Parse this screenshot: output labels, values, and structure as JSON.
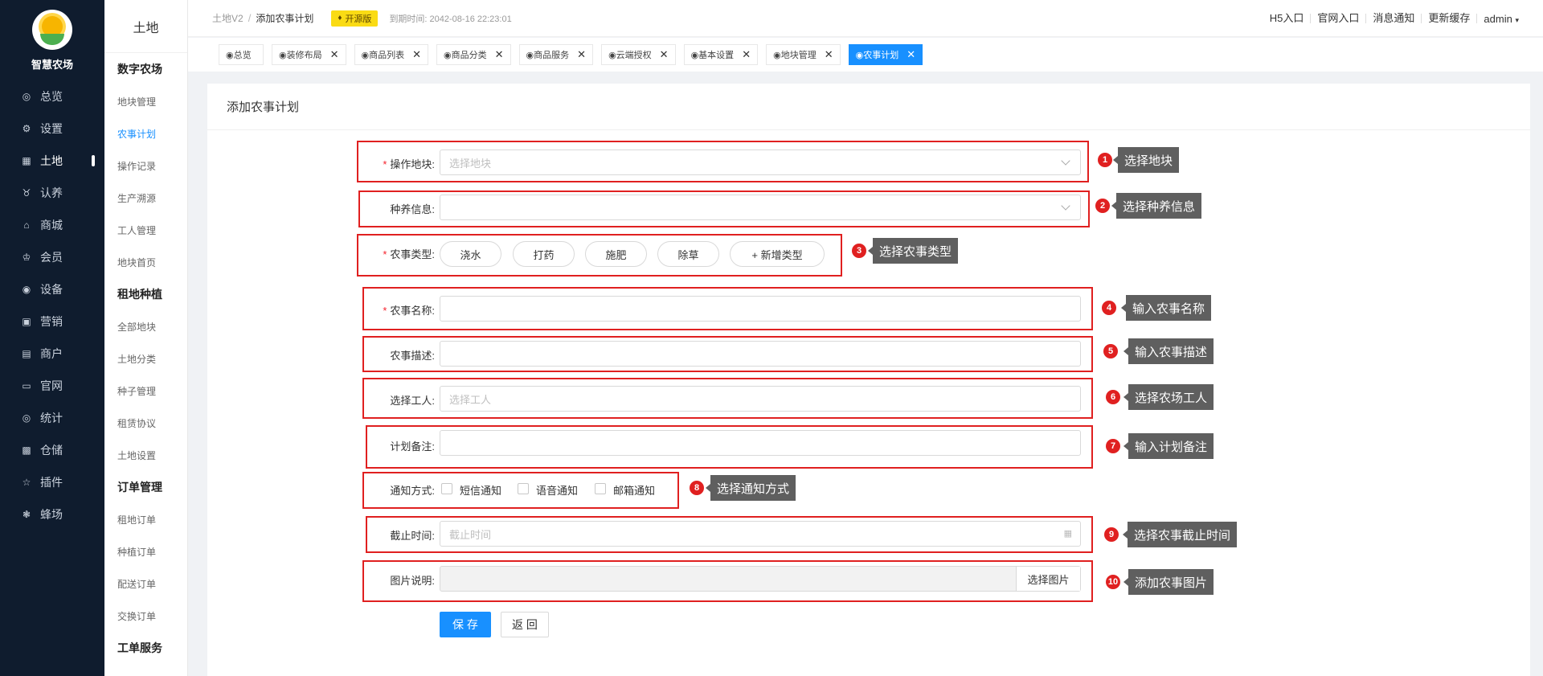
{
  "brand": {
    "name": "智慧农场"
  },
  "nav": [
    {
      "label": "总览",
      "icon": "dashboard-icon",
      "glyph": "◎"
    },
    {
      "label": "设置",
      "icon": "gear-icon",
      "glyph": "⚙"
    },
    {
      "label": "土地",
      "icon": "land-icon",
      "glyph": "▦"
    },
    {
      "label": "认养",
      "icon": "adopt-icon",
      "glyph": "♉"
    },
    {
      "label": "商城",
      "icon": "shop-icon",
      "glyph": "⌂"
    },
    {
      "label": "会员",
      "icon": "member-icon",
      "glyph": "♔"
    },
    {
      "label": "设备",
      "icon": "device-icon",
      "glyph": "◉"
    },
    {
      "label": "营销",
      "icon": "marketing-icon",
      "glyph": "▣"
    },
    {
      "label": "商户",
      "icon": "merchant-icon",
      "glyph": "▤"
    },
    {
      "label": "官网",
      "icon": "website-icon",
      "glyph": "▭"
    },
    {
      "label": "统计",
      "icon": "stats-icon",
      "glyph": "◎"
    },
    {
      "label": "仓储",
      "icon": "warehouse-icon",
      "glyph": "▩"
    },
    {
      "label": "插件",
      "icon": "plugin-icon",
      "glyph": "☆"
    },
    {
      "label": "蜂场",
      "icon": "bee-icon",
      "glyph": "❃"
    }
  ],
  "submenu": {
    "title": "土地",
    "groups": [
      {
        "title": "数字农场",
        "items": [
          "地块管理",
          "农事计划",
          "操作记录",
          "生产溯源",
          "工人管理",
          "地块首页"
        ]
      },
      {
        "title": "租地种植",
        "items": [
          "全部地块",
          "土地分类",
          "种子管理",
          "租赁协议",
          "土地设置"
        ]
      },
      {
        "title": "订单管理",
        "items": [
          "租地订单",
          "种植订单",
          "配送订单",
          "交换订单"
        ]
      },
      {
        "title": "工单服务",
        "items": []
      }
    ]
  },
  "header": {
    "crumb_root": "土地V2",
    "crumb_sep": "/",
    "crumb_current": "添加农事计划",
    "badge": "开源版",
    "expire": "到期时间: 2042-08-16 22:23:01",
    "links": [
      "H5入口",
      "官网入口",
      "消息通知",
      "更新缓存"
    ],
    "user": "admin"
  },
  "tabs": [
    {
      "label": "◉总览",
      "closable": false
    },
    {
      "label": "◉装修布局",
      "closable": true
    },
    {
      "label": "◉商品列表",
      "closable": true
    },
    {
      "label": "◉商品分类",
      "closable": true
    },
    {
      "label": "◉商品服务",
      "closable": true
    },
    {
      "label": "◉云端授权",
      "closable": true
    },
    {
      "label": "◉基本设置",
      "closable": true
    },
    {
      "label": "◉地块管理",
      "closable": true
    },
    {
      "label": "◉农事计划",
      "closable": true,
      "active": true
    }
  ],
  "form": {
    "title": "添加农事计划",
    "plot": {
      "label": "操作地块:",
      "required": true,
      "placeholder": "选择地块"
    },
    "breed": {
      "label": "种养信息:",
      "required": false,
      "placeholder": ""
    },
    "type": {
      "label": "农事类型:",
      "required": true,
      "options": [
        "浇水",
        "打药",
        "施肥",
        "除草",
        "+ 新增类型"
      ]
    },
    "name": {
      "label": "农事名称:",
      "required": true,
      "value": ""
    },
    "desc": {
      "label": "农事描述:",
      "required": false,
      "value": ""
    },
    "worker": {
      "label": "选择工人:",
      "required": false,
      "placeholder": "选择工人"
    },
    "note": {
      "label": "计划备注:",
      "required": false,
      "value": ""
    },
    "notify": {
      "label": "通知方式:",
      "options": [
        "短信通知",
        "语音通知",
        "邮箱通知"
      ]
    },
    "deadline": {
      "label": "截止时间:",
      "placeholder": "截止时间"
    },
    "image": {
      "label": "图片说明:",
      "button": "选择图片"
    },
    "save": "保 存",
    "back": "返 回"
  },
  "annotations": [
    {
      "num": "1",
      "text": "选择地块"
    },
    {
      "num": "2",
      "text": "选择种养信息"
    },
    {
      "num": "3",
      "text": "选择农事类型"
    },
    {
      "num": "4",
      "text": "输入农事名称"
    },
    {
      "num": "5",
      "text": "输入农事描述"
    },
    {
      "num": "6",
      "text": "选择农场工人"
    },
    {
      "num": "7",
      "text": "输入计划备注"
    },
    {
      "num": "8",
      "text": "选择通知方式"
    },
    {
      "num": "9",
      "text": "选择农事截止时间"
    },
    {
      "num": "10",
      "text": "添加农事图片"
    }
  ],
  "colors": {
    "nav_bg": "#0f1c2e",
    "primary": "#1890ff",
    "highlight": "#e02020",
    "badge": "#fadb14"
  }
}
